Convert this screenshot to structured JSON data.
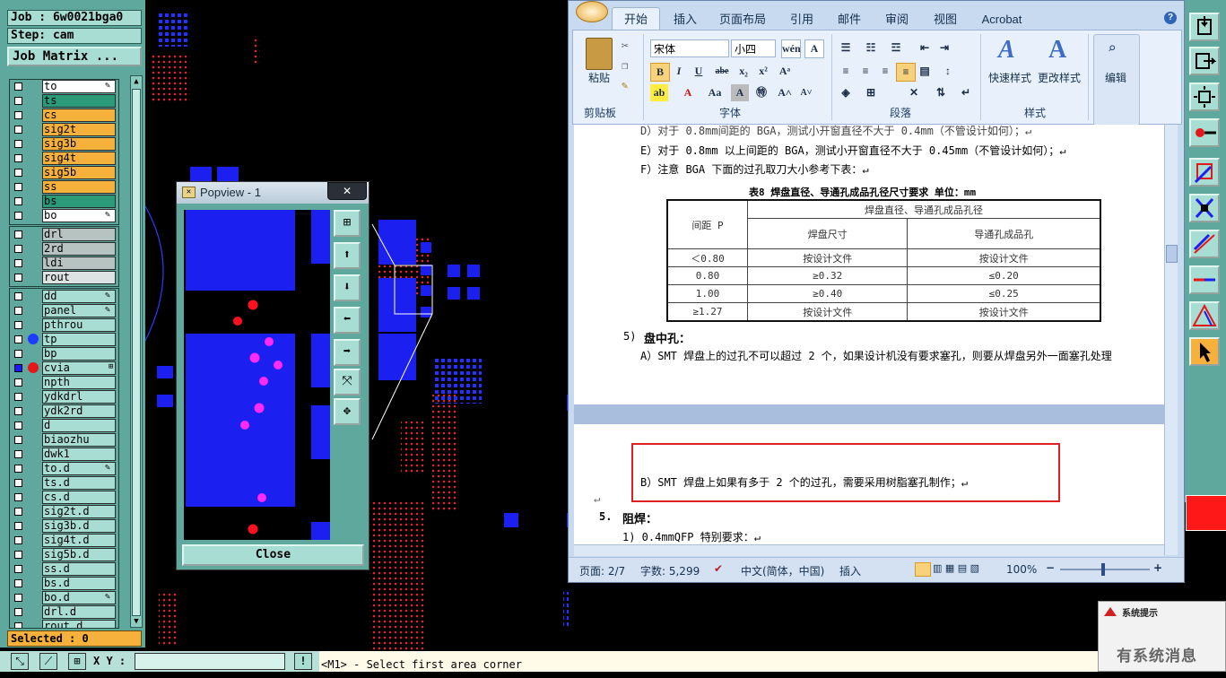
{
  "cam": {
    "job_label": "Job : 6w0021bga0",
    "step_label": "Step: cam",
    "job_matrix": "Job Matrix ...",
    "layers_board": [
      "to",
      "ts",
      "cs",
      "sig2t",
      "sig3b",
      "sig4t",
      "sig5b",
      "ss",
      "bs",
      "bo"
    ],
    "layers_drill": [
      "drl",
      "2rd",
      "ldi",
      "rout"
    ],
    "layers_misc": [
      "dd",
      "panel",
      "pthrou",
      "tp",
      "bp",
      "cvia",
      "npth",
      "ydkdrl",
      "ydk2rd",
      "d",
      "biaozhu",
      "dwk1",
      "to.d",
      "ts.d",
      "cs.d",
      "sig2t.d",
      "sig3b.d",
      "sig4t.d",
      "sig5b.d",
      "ss.d",
      "bs.d",
      "bo.d",
      "drl.d",
      "rout.d"
    ],
    "selected": "Selected : 0",
    "xy_label": "X Y :",
    "exclaim": "!",
    "status_msg": "<M1> - Select first area corner"
  },
  "popview": {
    "title": "Popview - 1",
    "close": "Close",
    "close_x": "✕"
  },
  "word": {
    "tabs": [
      "开始",
      "插入",
      "页面布局",
      "引用",
      "邮件",
      "审阅",
      "视图",
      "Acrobat"
    ],
    "font_name": "宋体",
    "font_size": "小四",
    "paste": "粘贴",
    "groups": [
      "剪贴板",
      "字体",
      "段落",
      "样式",
      "编辑"
    ],
    "quick_style": "快速样式",
    "change_style": "更改样式",
    "edit": "编辑",
    "lines": {
      "d_partial": "D）对于 0.8mm间距的 BGA，测试小开窗直径不大于 0.4mm（不管设计如何）；↵",
      "e": "E）对于 0.8mm 以上间距的 BGA，测试小开窗直径不大于 0.45mm（不管设计如何）；↵",
      "f": "F）注意 BGA 下面的过孔取刀大小参考下表：↵",
      "table_title": "表8   焊盘直径、导通孔成品孔径尺寸要求     单位：mm",
      "sec5_num": "5)",
      "sec5": "盘中孔：",
      "a": "A）SMT 焊盘上的过孔不可以超过 2 个，如果设计机没有要求塞孔，则要从焊盘另外一面塞孔处理",
      "b": "B）SMT 焊盘上如果有多于 2 个的过孔，需要采用树脂塞孔制作；↵",
      "enter": "↵",
      "sec_num": "5.",
      "sec_title": "阻焊：",
      "p1": "1)  0.4mmQFP 特别要求：↵"
    },
    "table": {
      "col1": "间距 P",
      "header": "焊盘直径、导通孔成品孔径",
      "sub1": "焊盘尺寸",
      "sub2": "导通孔成品孔",
      "rows": [
        [
          "＜0.80",
          "按设计文件",
          "按设计文件"
        ],
        [
          "0.80",
          "≥0.32",
          "≤0.20"
        ],
        [
          "1.00",
          "≥0.40",
          "≤0.25"
        ],
        [
          "≥1.27",
          "按设计文件",
          "按设计文件"
        ]
      ]
    },
    "status": {
      "page": "页面: 2/7",
      "words": "字数: 5,299",
      "lang": "中文(简体，中国)",
      "insert": "插入",
      "zoom": "100%",
      "minus": "−",
      "plus": "+"
    }
  },
  "notify": {
    "title": "系统提示",
    "message": "有系统消息"
  },
  "colors": {
    "cam_teal": "#5fa89e",
    "layer_orange": "#f6b03c",
    "layer_green": "#2a9a78",
    "layer_gray": "#b7c3c1",
    "pad_blue": "#1b1ff0",
    "word_blue": "#c8daf0"
  }
}
